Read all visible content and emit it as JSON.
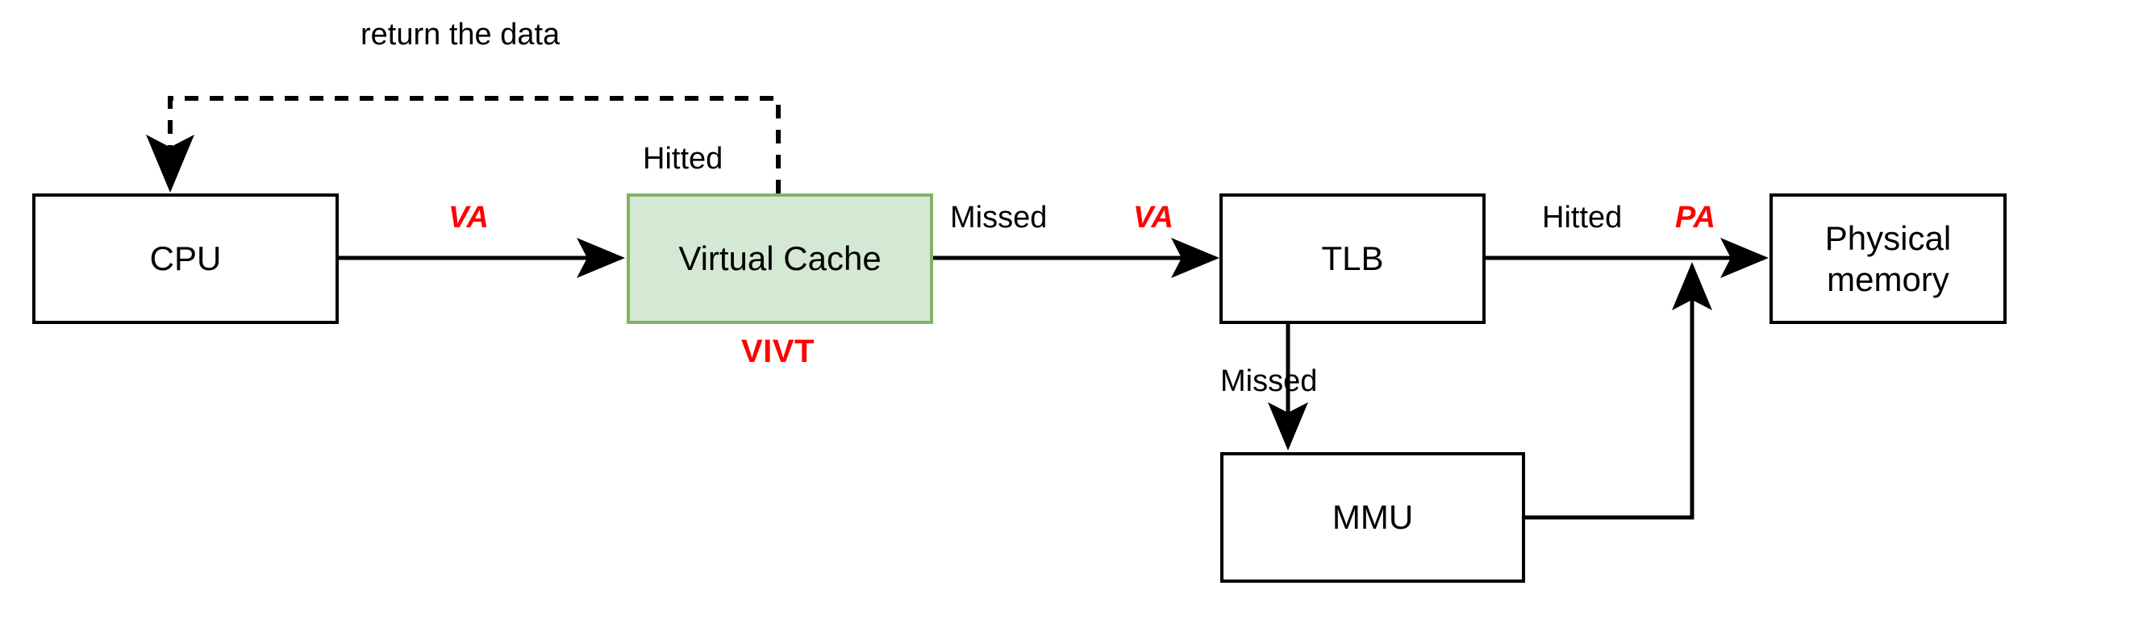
{
  "diagram": {
    "title": "VIVT virtual cache address translation flow",
    "background_color": "#ffffff",
    "colors": {
      "stroke": "#000000",
      "accent_red": "#ff0000",
      "cache_fill": "#d5e8d4",
      "cache_border": "#82b366"
    },
    "nodes": [
      {
        "id": "cpu",
        "label": "CPU",
        "fill": "#ffffff",
        "border": "#000000"
      },
      {
        "id": "virtual_cache",
        "label": "Virtual Cache",
        "fill": "#d5e8d4",
        "border": "#82b366"
      },
      {
        "id": "tlb",
        "label": "TLB",
        "fill": "#ffffff",
        "border": "#000000"
      },
      {
        "id": "mmu",
        "label": "MMU",
        "fill": "#ffffff",
        "border": "#000000"
      },
      {
        "id": "physical_memory",
        "label": "Physical\nmemory",
        "fill": "#ffffff",
        "border": "#000000"
      }
    ],
    "labels": {
      "return_the_data": "return the data",
      "hitted_cache": "Hitted",
      "vivt": "VIVT",
      "missed_cache": "Missed",
      "va_cpu_to_cache": "VA",
      "va_cache_to_tlb": "VA",
      "hitted_tlb": "Hitted",
      "pa_tlb_to_memory": "PA",
      "missed_tlb": "Missed"
    },
    "edges": [
      {
        "id": "cpu-to-cache",
        "from": "cpu",
        "to": "virtual_cache",
        "label": "VA",
        "style": "solid",
        "arrow": true
      },
      {
        "id": "cache-to-tlb",
        "from": "virtual_cache",
        "to": "tlb",
        "label": "Missed / VA",
        "style": "solid",
        "arrow": true
      },
      {
        "id": "cache-to-cpu",
        "from": "virtual_cache",
        "to": "cpu",
        "label": "Hitted / return the data",
        "style": "dashed",
        "arrow": true
      },
      {
        "id": "tlb-to-memory",
        "from": "tlb",
        "to": "physical_memory",
        "label": "Hitted / PA",
        "style": "solid",
        "arrow": true
      },
      {
        "id": "tlb-to-mmu",
        "from": "tlb",
        "to": "mmu",
        "label": "Missed",
        "style": "solid",
        "arrow": true
      },
      {
        "id": "mmu-to-pa-path",
        "from": "mmu",
        "to": "tlb-to-memory",
        "label": "",
        "style": "solid",
        "arrow": true
      }
    ]
  }
}
